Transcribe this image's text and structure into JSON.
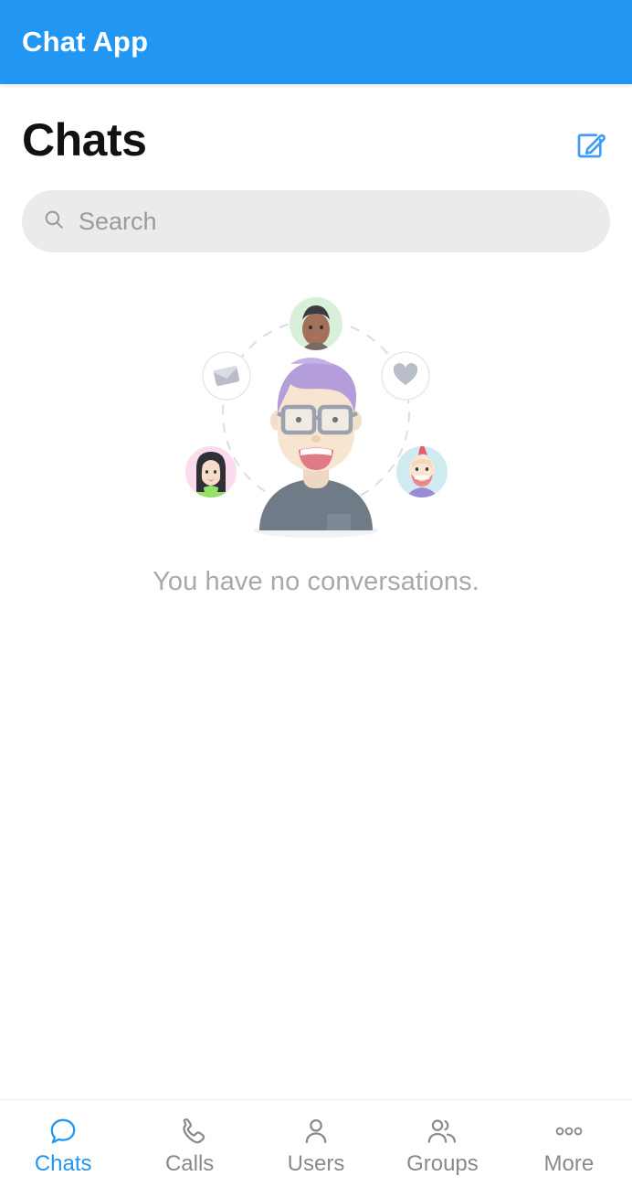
{
  "theme": {
    "accent": "#2196f3",
    "appbar_bg": "#2196f3",
    "appbar_text": "#ffffff",
    "page_bg": "#ffffff",
    "search_bg": "#ebebeb",
    "muted_text": "#a9a9a9",
    "nav_inactive": "#8a8a8a"
  },
  "appbar": {
    "title": "Chat App"
  },
  "header": {
    "title": "Chats",
    "compose_icon": "compose-pencil-square-icon"
  },
  "search": {
    "placeholder": "Search",
    "value": "",
    "icon": "search-icon"
  },
  "empty_state": {
    "message": "You have no conversations.",
    "illustration": {
      "name": "no-conversations-illustration",
      "center_avatar": {
        "name": "center-avatar-person",
        "hair_color": "#b39ddb",
        "skin_color": "#f5e0cd",
        "shirt_color": "#6f7b87",
        "glasses_color": "#9aa3ad"
      },
      "satellites": [
        {
          "name": "satellite-avatar-top",
          "icon": "person-avatar",
          "bg": "#d6efd6"
        },
        {
          "name": "satellite-envelope-left",
          "icon": "envelope-icon",
          "bg": "#ffffff"
        },
        {
          "name": "satellite-heart-right",
          "icon": "heart-icon",
          "bg": "#ffffff"
        },
        {
          "name": "satellite-avatar-bottom-left",
          "icon": "person-avatar",
          "bg": "#fbddef"
        },
        {
          "name": "satellite-avatar-bottom-right",
          "icon": "person-avatar",
          "bg": "#cfeaf0"
        }
      ]
    }
  },
  "bottom_nav": {
    "active_index": 0,
    "items": [
      {
        "label": "Chats",
        "icon": "chat-bubble-icon"
      },
      {
        "label": "Calls",
        "icon": "phone-handset-icon"
      },
      {
        "label": "Users",
        "icon": "person-icon"
      },
      {
        "label": "Groups",
        "icon": "people-group-icon"
      },
      {
        "label": "More",
        "icon": "ellipsis-icon"
      }
    ]
  }
}
